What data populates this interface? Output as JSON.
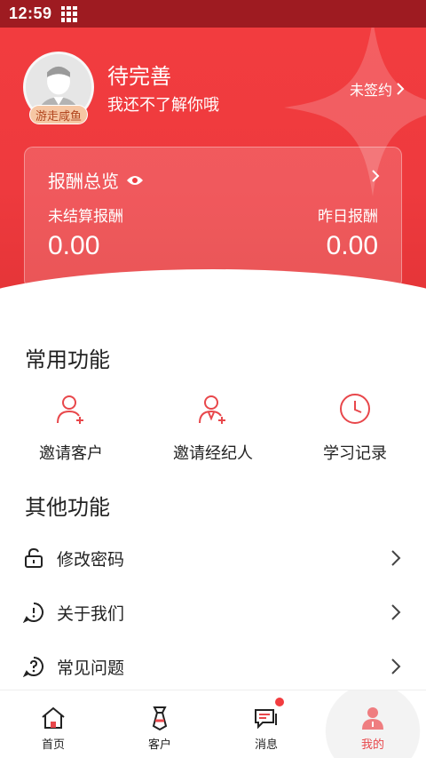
{
  "status_bar": {
    "time": "12:59"
  },
  "profile": {
    "name": "待完善",
    "description": "我还不了解你哦",
    "badge": "游走咸鱼",
    "sign_link": "未签约"
  },
  "earnings": {
    "title": "报酬总览",
    "unsettled_label": "未结算报酬",
    "unsettled_value": "0.00",
    "yesterday_label": "昨日报酬",
    "yesterday_value": "0.00"
  },
  "common_functions": {
    "title": "常用功能",
    "items": [
      {
        "label": "邀请客户",
        "icon": "invite-customer-icon"
      },
      {
        "label": "邀请经纪人",
        "icon": "invite-agent-icon"
      },
      {
        "label": "学习记录",
        "icon": "clock-icon"
      }
    ]
  },
  "other_functions": {
    "title": "其他功能",
    "items": [
      {
        "label": "修改密码",
        "icon": "unlock-icon"
      },
      {
        "label": "关于我们",
        "icon": "info-icon"
      },
      {
        "label": "常见问题",
        "icon": "question-icon"
      }
    ]
  },
  "tabbar": {
    "items": [
      {
        "label": "首页",
        "icon": "home-icon"
      },
      {
        "label": "客户",
        "icon": "tie-icon"
      },
      {
        "label": "消息",
        "icon": "message-icon"
      },
      {
        "label": "我的",
        "icon": "person-icon"
      }
    ]
  },
  "colors": {
    "accent": "#f23c3f",
    "status_bar": "#9e1b21",
    "icon_red": "#e8474b"
  }
}
